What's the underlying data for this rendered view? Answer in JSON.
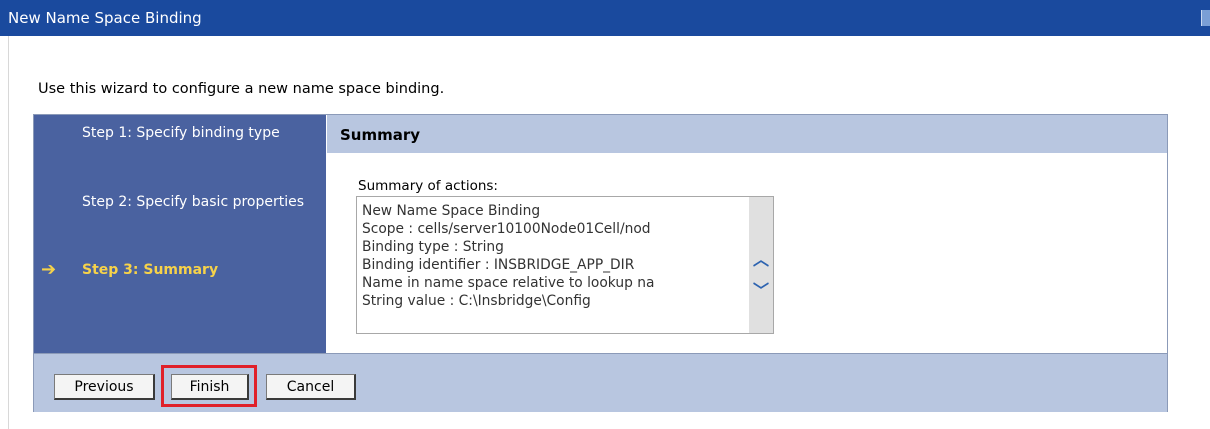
{
  "window": {
    "title": "New Name Space Binding"
  },
  "intro_text": "Use this wizard to configure a new name space binding.",
  "steps": [
    {
      "label": "Step 1: Specify binding type",
      "current": false
    },
    {
      "label": "Step 2: Specify basic properties",
      "current": false
    },
    {
      "label": "Step 3: Summary",
      "current": true
    }
  ],
  "panel": {
    "title": "Summary",
    "summary_label": "Summary of actions:",
    "summary_lines": [
      "New Name Space Binding",
      "Scope : cells/server10100Node01Cell/nod",
      "Binding type : String",
      "Binding identifier : INSBRIDGE_APP_DIR",
      "Name in name space relative to lookup na",
      "String value : C:\\Insbridge\\Config"
    ]
  },
  "buttons": {
    "previous": "Previous",
    "finish": "Finish",
    "cancel": "Cancel"
  },
  "icons": {
    "current_step": "right-arrow-icon",
    "scroll_up": "chevron-up-icon",
    "scroll_down": "chevron-down-icon"
  },
  "colors": {
    "title_bar": "#1a4a9e",
    "steps_bg": "#4a62a0",
    "current_step_text": "#f6d24a",
    "panel_header_bg": "#b8c6e0",
    "highlight": "#e0202a"
  }
}
